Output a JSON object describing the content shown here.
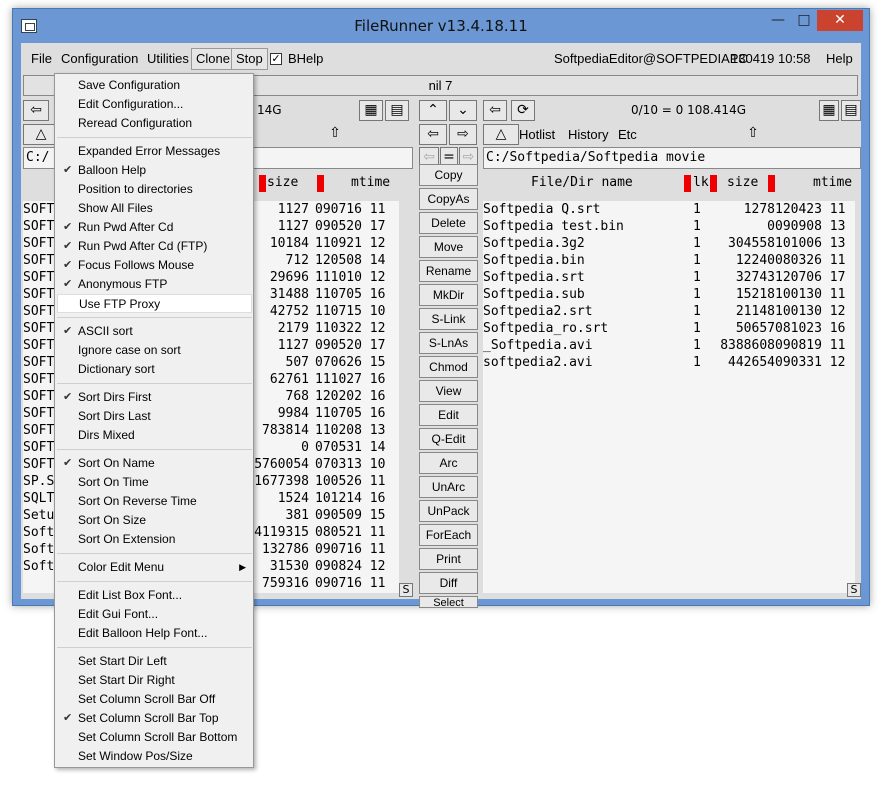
{
  "window": {
    "title": "FileRunner  v13.4.18.11"
  },
  "menubar": {
    "file": "File",
    "configuration": "Configuration",
    "utilities": "Utilities",
    "clone": "Clone",
    "stop": "Stop",
    "bhelp": "BHelp",
    "user": "SoftpediaEditor@SOFTPEDIAPC",
    "datetime": "130419 10:58",
    "help": "Help"
  },
  "status": "nil 7",
  "left_panel": {
    "disk": "14G",
    "path": "C:/",
    "col_size": "size",
    "col_mtime": "mtime",
    "names": [
      "SOFT",
      "SOFT",
      "SOFT",
      "SOFT",
      "SOFT",
      "SOFT",
      "SOFT",
      "SOFT",
      "SOFT",
      "SOFT",
      "SOFT",
      "SOFT",
      "SOFT",
      "SOFT",
      "SOFT",
      "SOFT",
      "SP.S",
      "SQLT",
      "Setu",
      "Soft",
      "Soft",
      "Soft"
    ],
    "sizes": [
      "1127",
      "1127",
      "10184",
      "712",
      "29696",
      "31488",
      "42752",
      "2179",
      "1127",
      "507",
      "62761",
      "768",
      "9984",
      "783814",
      "0",
      "5760054",
      "1677398",
      "1524",
      "381",
      "4119315",
      "132786",
      "31530",
      "759316"
    ],
    "dates": [
      "090716 11",
      "090520 17",
      "110921 12",
      "120508 14",
      "111010 12",
      "110705 16",
      "110715 10",
      "110322 12",
      "090520 17",
      "070626 15",
      "111027 16",
      "120202 16",
      "110705 16",
      "110208 13",
      "070531 14",
      "070313 10",
      "100526 11",
      "101214 16",
      "090509 15",
      "080521 11",
      "090716 11",
      "090824 12",
      "090716 11"
    ]
  },
  "right_panel": {
    "stats": "0/10 = 0  108.414G",
    "hotlist": "Hotlist",
    "history": "History",
    "etc": "Etc",
    "path": "C:/Softpedia/Softpedia movie",
    "col_name": "File/Dir name",
    "col_lk": "lk",
    "col_size": "size",
    "col_mtime": "mtime",
    "rows": [
      {
        "name": "Softpedia Q.srt",
        "lk": "1",
        "size": "1278",
        "mtime": "120423 11"
      },
      {
        "name": "Softpedia test.bin",
        "lk": "1",
        "size": "0",
        "mtime": "090908 13"
      },
      {
        "name": "Softpedia.3g2",
        "lk": "1",
        "size": "304558",
        "mtime": "101006 13"
      },
      {
        "name": "Softpedia.bin",
        "lk": "1",
        "size": "12240",
        "mtime": "080326 11"
      },
      {
        "name": "Softpedia.srt",
        "lk": "1",
        "size": "32743",
        "mtime": "120706 17"
      },
      {
        "name": "Softpedia.sub",
        "lk": "1",
        "size": "15218",
        "mtime": "100130 11"
      },
      {
        "name": "Softpedia2.srt",
        "lk": "1",
        "size": "21148",
        "mtime": "100130 12"
      },
      {
        "name": "Softpedia_ro.srt",
        "lk": "1",
        "size": "50657",
        "mtime": "081023 16"
      },
      {
        "name": "_Softpedia.avi",
        "lk": "1",
        "size": "8388608",
        "mtime": "090819 11"
      },
      {
        "name": "softpedia2.avi",
        "lk": "1",
        "size": "442654",
        "mtime": "090331 12"
      }
    ]
  },
  "middle": {
    "eq": "=",
    "buttons": [
      "Copy",
      "CopyAs",
      "Delete",
      "Move",
      "Rename",
      "MkDir",
      "S-Link",
      "S-LnAs",
      "Chmod",
      "View",
      "Edit",
      "Q-Edit",
      "Arc",
      "UnArc",
      "UnPack",
      "ForEach",
      "Print",
      "Diff",
      "Select"
    ]
  },
  "scroll_s": "S",
  "config_menu": {
    "items": [
      {
        "label": "Save Configuration",
        "checked": false
      },
      {
        "label": "Edit Configuration...",
        "checked": false
      },
      {
        "label": "Reread Configuration",
        "checked": false
      },
      {
        "sep": true
      },
      {
        "label": "Expanded Error Messages",
        "checked": false
      },
      {
        "label": "Balloon Help",
        "checked": true
      },
      {
        "label": "Position to directories",
        "checked": false
      },
      {
        "label": "Show All Files",
        "checked": false
      },
      {
        "label": "Run Pwd After Cd",
        "checked": true
      },
      {
        "label": "Run Pwd After Cd (FTP)",
        "checked": true
      },
      {
        "label": "Focus Follows Mouse",
        "checked": true
      },
      {
        "label": "Anonymous FTP",
        "checked": true
      },
      {
        "label": "Use FTP Proxy",
        "checked": false,
        "highlighted": true
      },
      {
        "sep": true
      },
      {
        "label": "ASCII sort",
        "checked": true
      },
      {
        "label": "Ignore case on sort",
        "checked": false
      },
      {
        "label": "Dictionary sort",
        "checked": false
      },
      {
        "sep": true
      },
      {
        "label": "Sort Dirs First",
        "checked": true
      },
      {
        "label": "Sort Dirs Last",
        "checked": false
      },
      {
        "label": "Dirs Mixed",
        "checked": false
      },
      {
        "sep": true
      },
      {
        "label": "Sort On Name",
        "checked": true
      },
      {
        "label": "Sort On Time",
        "checked": false
      },
      {
        "label": "Sort On Reverse Time",
        "checked": false
      },
      {
        "label": "Sort On Size",
        "checked": false
      },
      {
        "label": "Sort On Extension",
        "checked": false
      },
      {
        "sep": true
      },
      {
        "label": "Color Edit Menu",
        "checked": false,
        "submenu": true
      },
      {
        "sep": true
      },
      {
        "label": "Edit List Box Font...",
        "checked": false
      },
      {
        "label": "Edit Gui Font...",
        "checked": false
      },
      {
        "label": "Edit Balloon Help Font...",
        "checked": false
      },
      {
        "sep": true
      },
      {
        "label": "Set Start Dir Left",
        "checked": false
      },
      {
        "label": "Set Start Dir Right",
        "checked": false
      },
      {
        "label": "Set Column Scroll Bar Off",
        "checked": false
      },
      {
        "label": "Set Column Scroll Bar Top",
        "checked": true
      },
      {
        "label": "Set Column Scroll Bar Bottom",
        "checked": false
      },
      {
        "label": "Set Window Pos/Size",
        "checked": false
      }
    ]
  }
}
